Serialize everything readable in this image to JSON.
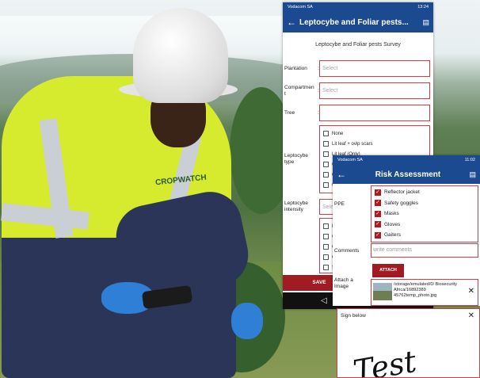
{
  "phone1": {
    "status": {
      "carrier": "Vodacom SA",
      "time": "13:24"
    },
    "title": "Leptocybe and Foliar pests...",
    "form_title": "Leptocybe and Foliar pests Survey",
    "fields": {
      "plantation_label": "Plantation",
      "plantation_value": "Select",
      "compartment_label": "Compartmen t",
      "compartment_value": "Select",
      "tree_label": "Tree",
      "leptocybe_type_label": "Leptocybe type",
      "leptocybe_type_options": [
        "None",
        "Lit leaf + ovip scars",
        "Lit leaf (Only)",
        "C",
        "C",
        "C"
      ],
      "leptocybe_intensity_label": "Leptocybe intensity",
      "leptocybe_intensity_value": "Sele",
      "extra_options": [
        "N",
        "C",
        "C",
        "C",
        "S"
      ]
    },
    "save_label": "SAVE",
    "nav_back": "◁"
  },
  "phone2": {
    "status": {
      "carrier": "Vodacom SA",
      "time": "11:02"
    },
    "title": "Risk Assessment",
    "ppe_label": "PPE",
    "ppe_items": [
      "Reflector jacket",
      "Safety goggles",
      "Masks",
      "Gloves",
      "Gaiters"
    ],
    "comments_label": "Comments",
    "comments_placeholder": "write comments",
    "attach_label": "Attach a Image",
    "attach_button": "ATTACH",
    "attachment_path": "/storage/emulated/0/ Biosecurity Africa/16892389 45762temp_photo.jpg"
  },
  "signature": {
    "header": "Sign below",
    "text": "Test"
  },
  "photo": {
    "jacket_logo": "CROPWATCH"
  },
  "colors": {
    "appbar": "#1c4a90",
    "accent_red": "#a01c22",
    "border_red": "#c9404a"
  }
}
